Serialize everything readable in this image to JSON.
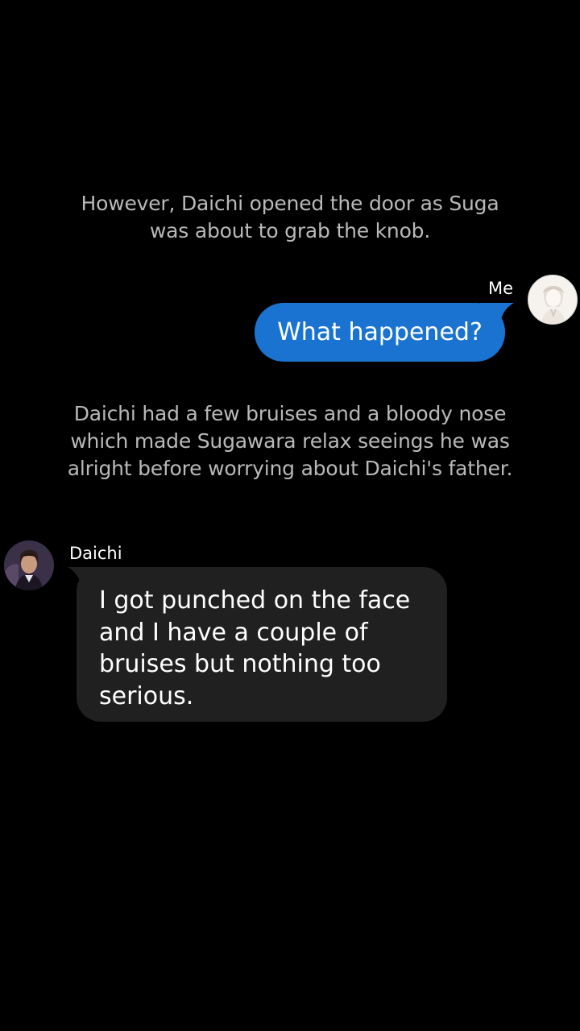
{
  "story": {
    "narration_1": "However, Daichi opened the door as Suga was about to grab the knob.",
    "narration_2": "Daichi had a few bruises and a bloody nose which made Sugawara relax seeings he was alright before worrying about Daichi's father."
  },
  "messages": [
    {
      "sender": "Me",
      "text": "What happened?",
      "avatar_icon": "me-avatar-icon",
      "bubble_color": "#1a73d1"
    },
    {
      "sender": "Daichi",
      "text": "I got punched on the face and I have a couple of bruises but nothing too serious.",
      "avatar_icon": "daichi-avatar-icon",
      "bubble_color": "#202020"
    }
  ],
  "colors": {
    "background": "#000000",
    "narration_text": "#b9b9b9",
    "message_text": "#ffffff"
  }
}
